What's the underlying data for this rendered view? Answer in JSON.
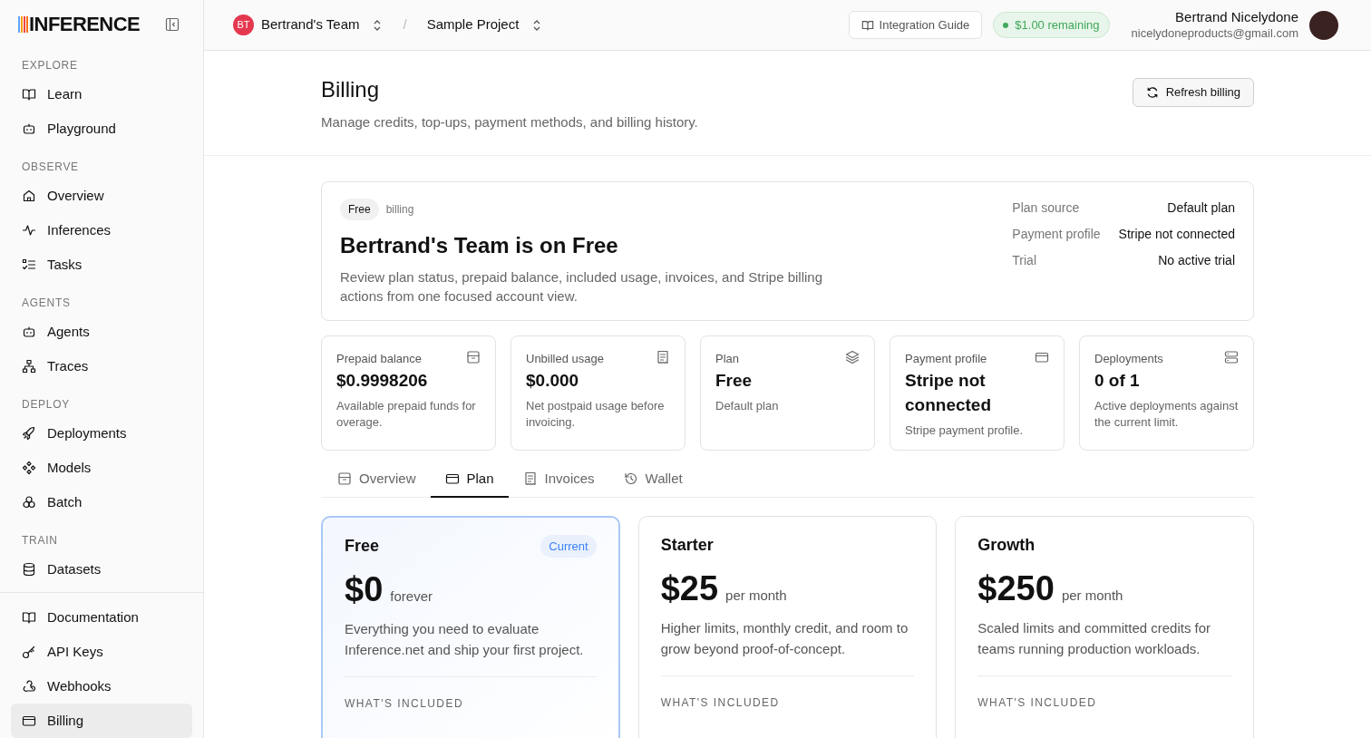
{
  "logo": {
    "text": "INFERENCE"
  },
  "sidebar": {
    "sections": [
      {
        "title": "EXPLORE",
        "items": [
          {
            "label": "Learn",
            "selected": false
          },
          {
            "label": "Playground",
            "selected": false
          }
        ]
      },
      {
        "title": "OBSERVE",
        "items": [
          {
            "label": "Overview",
            "selected": false
          },
          {
            "label": "Inferences",
            "selected": false
          },
          {
            "label": "Tasks",
            "selected": false
          }
        ]
      },
      {
        "title": "AGENTS",
        "items": [
          {
            "label": "Agents",
            "selected": false
          },
          {
            "label": "Traces",
            "selected": false
          }
        ]
      },
      {
        "title": "DEPLOY",
        "items": [
          {
            "label": "Deployments",
            "selected": false
          },
          {
            "label": "Models",
            "selected": false
          },
          {
            "label": "Batch",
            "selected": false
          }
        ]
      },
      {
        "title": "TRAIN",
        "items": [
          {
            "label": "Datasets",
            "selected": false
          }
        ]
      }
    ],
    "footer_items": [
      {
        "label": "Documentation",
        "selected": false
      },
      {
        "label": "API Keys",
        "selected": false
      },
      {
        "label": "Webhooks",
        "selected": false
      },
      {
        "label": "Billing",
        "selected": true
      }
    ]
  },
  "header": {
    "team": {
      "initials": "BT",
      "name": "Bertrand's Team"
    },
    "separator": "/",
    "project": "Sample Project",
    "guide_button": "Integration Guide",
    "credit_badge": "$1.00 remaining",
    "user": {
      "name": "Bertrand Nicelydone",
      "email": "nicelydoneproducts@gmail.com"
    }
  },
  "page": {
    "title": "Billing",
    "subtitle": "Manage credits, top-ups, payment methods, and billing history.",
    "refresh_button": "Refresh billing"
  },
  "summary": {
    "plan_badge": "Free",
    "badge_caption": "billing",
    "heading": "Bertrand's Team is on Free",
    "description": "Review plan status, prepaid balance, included usage, invoices, and Stripe billing actions from one focused account view.",
    "details": [
      {
        "label": "Plan source",
        "value": "Default plan"
      },
      {
        "label": "Payment profile",
        "value": "Stripe not connected"
      },
      {
        "label": "Trial",
        "value": "No active trial"
      }
    ]
  },
  "stats": [
    {
      "label": "Prepaid balance",
      "value": "$0.9998206",
      "note": "Available prepaid funds for overage."
    },
    {
      "label": "Unbilled usage",
      "value": "$0.000",
      "note": "Net postpaid usage before invoicing."
    },
    {
      "label": "Plan",
      "value": "Free",
      "note": "Default plan"
    },
    {
      "label": "Payment profile",
      "value": "Stripe not connected",
      "note": "Stripe payment profile."
    },
    {
      "label": "Deployments",
      "value": "0 of 1",
      "note": "Active deployments against the current limit."
    }
  ],
  "tabs": [
    {
      "label": "Overview",
      "selected": false
    },
    {
      "label": "Plan",
      "selected": true
    },
    {
      "label": "Invoices",
      "selected": false
    },
    {
      "label": "Wallet",
      "selected": false
    }
  ],
  "plans": [
    {
      "name": "Free",
      "current": true,
      "badge": "Current",
      "price": "$0",
      "period": "forever",
      "description": "Everything you need to evaluate Inference.net and ship your first project.",
      "included_heading": "WHAT'S INCLUDED"
    },
    {
      "name": "Starter",
      "current": false,
      "price": "$25",
      "period": "per month",
      "description": "Higher limits, monthly credit, and room to grow beyond proof-of-concept.",
      "included_heading": "WHAT'S INCLUDED"
    },
    {
      "name": "Growth",
      "current": false,
      "price": "$250",
      "period": "per month",
      "description": "Scaled limits and committed credits for teams running production workloads.",
      "included_heading": "WHAT'S INCLUDED"
    }
  ]
}
